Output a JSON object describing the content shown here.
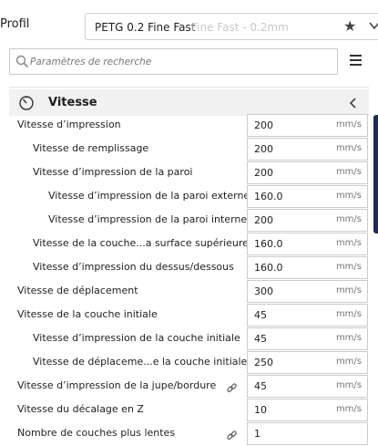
{
  "profile": {
    "label": "Profil",
    "name": "PETG 0.2 Fine Fast",
    "suffix": "- Fine Fast - 0.2mm"
  },
  "search": {
    "placeholder": "Paramètres de recherche"
  },
  "section": {
    "title": "Vitesse"
  },
  "settings": [
    {
      "label": "Vitesse d’impression",
      "value": "200",
      "unit": "mm/s",
      "level": 0,
      "link": false
    },
    {
      "label": "Vitesse de remplissage",
      "value": "200",
      "unit": "mm/s",
      "level": 1,
      "link": false
    },
    {
      "label": "Vitesse d’impression de la paroi",
      "value": "200",
      "unit": "mm/s",
      "level": 1,
      "link": false
    },
    {
      "label": "Vitesse d’impression de la paroi externe",
      "value": "160.0",
      "unit": "mm/s",
      "level": 2,
      "link": false
    },
    {
      "label": "Vitesse d’impression de la paroi interne",
      "value": "200",
      "unit": "mm/s",
      "level": 2,
      "link": false
    },
    {
      "label": "Vitesse de la couche...a surface supérieure",
      "value": "160.0",
      "unit": "mm/s",
      "level": 1,
      "link": false
    },
    {
      "label": "Vitesse d’impression du dessus/dessous",
      "value": "160.0",
      "unit": "mm/s",
      "level": 1,
      "link": false
    },
    {
      "label": "Vitesse de déplacement",
      "value": "300",
      "unit": "mm/s",
      "level": 0,
      "link": false
    },
    {
      "label": "Vitesse de la couche initiale",
      "value": "45",
      "unit": "mm/s",
      "level": 0,
      "link": false
    },
    {
      "label": "Vitesse d’impression de la couche initiale",
      "value": "45",
      "unit": "mm/s",
      "level": 1,
      "link": false
    },
    {
      "label": "Vitesse de déplaceme...e la couche initiale",
      "value": "250",
      "unit": "mm/s",
      "level": 1,
      "link": false
    },
    {
      "label": "Vitesse d’impression de la jupe/bordure",
      "value": "45",
      "unit": "mm/s",
      "level": 0,
      "link": true
    },
    {
      "label": "Vitesse du décalage en Z",
      "value": "10",
      "unit": "mm/s",
      "level": 0,
      "link": false
    },
    {
      "label": "Nombre de couches plus lentes",
      "value": "1",
      "unit": "",
      "level": 0,
      "link": true
    }
  ]
}
